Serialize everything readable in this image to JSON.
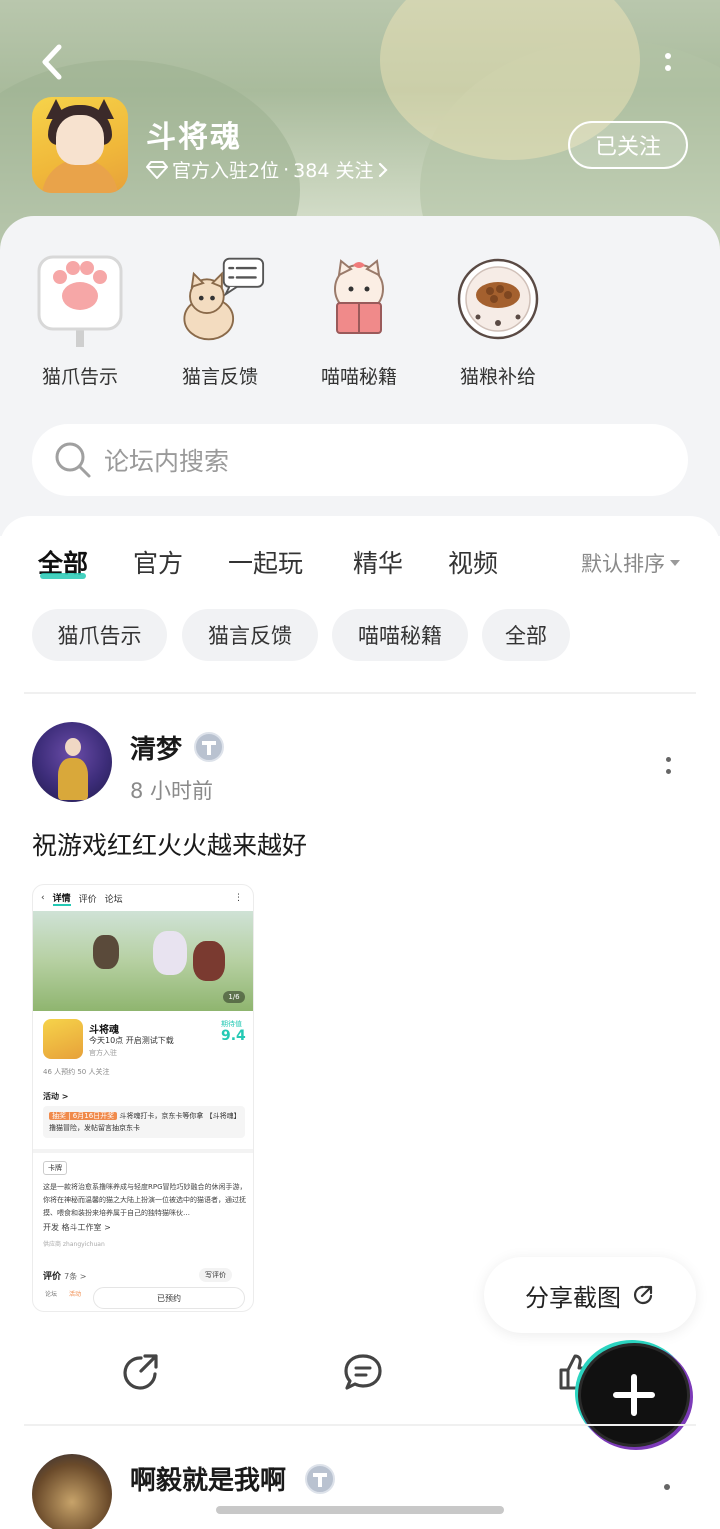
{
  "header": {
    "app_title": "斗将魂",
    "sub_official": "官方入驻2位",
    "sub_dot": "·",
    "sub_followers": "384 关注",
    "follow_label": "已关注"
  },
  "features": [
    {
      "label": "猫爪告示",
      "icon": "cat-paw-sign-icon"
    },
    {
      "label": "猫言反馈",
      "icon": "cat-feedback-icon"
    },
    {
      "label": "喵喵秘籍",
      "icon": "cat-book-icon"
    },
    {
      "label": "猫粮补给",
      "icon": "cat-food-bowl-icon"
    }
  ],
  "search": {
    "placeholder": "论坛内搜索"
  },
  "tabs": [
    {
      "label": "全部",
      "active": true
    },
    {
      "label": "官方"
    },
    {
      "label": "一起玩"
    },
    {
      "label": "精华"
    },
    {
      "label": "视频"
    }
  ],
  "sort_label": "默认排序",
  "chips": [
    "猫爪告示",
    "猫言反馈",
    "喵喵秘籍",
    "全部"
  ],
  "post": {
    "user": "清梦",
    "time": "8 小时前",
    "text": "祝游戏红红火火越来越好",
    "screenshot": {
      "tab_detail": "详情",
      "tab_review": "评价",
      "tab_forum": "论坛",
      "page_indicator": "1/6",
      "game_name": "斗将魂",
      "game_status": "今天10点 开启测试下载",
      "game_official": "官方入驻",
      "score_label": "期待值",
      "score": "9.4",
      "stats": "46 人预约    50 人关注",
      "activity_title": "活动 >",
      "activity_badge": "抽奖 | 6月16日开奖",
      "activity_text": "斗将魂打卡，京东卡等你拿 【斗将魂】撸猫冒险，发帖留言抽京东卡",
      "tag": "卡牌",
      "description": "这是一款将治愈系撸咪养成与轻度RPG冒险巧妙融合的休闲手游，你将在神秘而温馨的猫之大陆上扮演一位被选中的猫语者，通过抚摸、喂食和装扮来培养属于自己的独特猫咪伙…",
      "developer": "开发  格斗工作室 >",
      "publisher": "供应商  zhangyichuan",
      "reviews_title": "评价",
      "reviews_count": "7条 >",
      "write_review": "写评价",
      "footer_forum": "论坛",
      "footer_activity": "活动",
      "booked": "已预约"
    }
  },
  "share_screenshot_label": "分享截图",
  "next_post": {
    "user": "啊毅就是我啊"
  },
  "colors": {
    "accent": "#24c9b4",
    "fab": "#111111"
  }
}
